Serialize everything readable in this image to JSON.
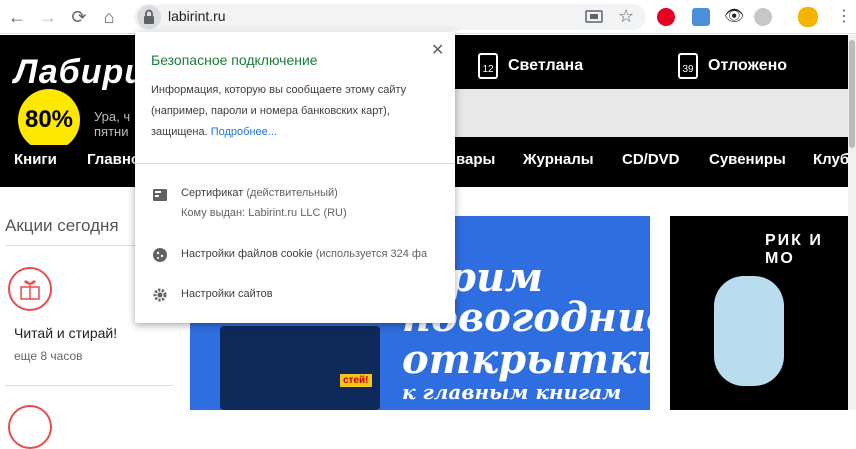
{
  "browser": {
    "url": "labirint.ru",
    "nav": {
      "back": "←",
      "forward": "→",
      "reload": "⟳",
      "home": "⌂"
    }
  },
  "header": {
    "logo": "Лабири",
    "badge": "80%",
    "promo_line1": "Ура, ч",
    "promo_line2": "пятни",
    "user_name": "Светлана",
    "user_count": "12",
    "deferred_label": "Отложено",
    "deferred_count": "39"
  },
  "menu": {
    "items": [
      "Книги",
      "Главно",
      "вары",
      "Журналы",
      "CD/DVD",
      "Сувениры",
      "Клуб"
    ]
  },
  "sidebar": {
    "title": "Акции сегодня",
    "action_title": "Читай и стирай!",
    "action_subtitle": "еще 8 часов"
  },
  "banner": {
    "line1": "рим",
    "line2": "новогодние",
    "line3": "открытки",
    "line4": "к главным книгам",
    "tag": "стей!"
  },
  "rick_banner": {
    "title": "РИК И МО"
  },
  "popup": {
    "title": "Безопасное подключение",
    "text": "Информация, которую вы сообщаете этому сайту (например, пароли и номера банковских карт), защищена.",
    "more_link": "Подробнее...",
    "certificate_label": "Сертификат",
    "certificate_status": "(действительный)",
    "issued_to": "Кому выдан: Labirint.ru  LLC (RU)",
    "cookies_label": "Настройки файлов cookie",
    "cookies_note": "(используется 324 фа",
    "site_settings_label": "Настройки сайтов"
  },
  "colors": {
    "secure_green": "#188038",
    "link_blue": "#1a73e8",
    "badge_yellow": "#ffe800",
    "banner_blue": "#2f6ee0"
  }
}
